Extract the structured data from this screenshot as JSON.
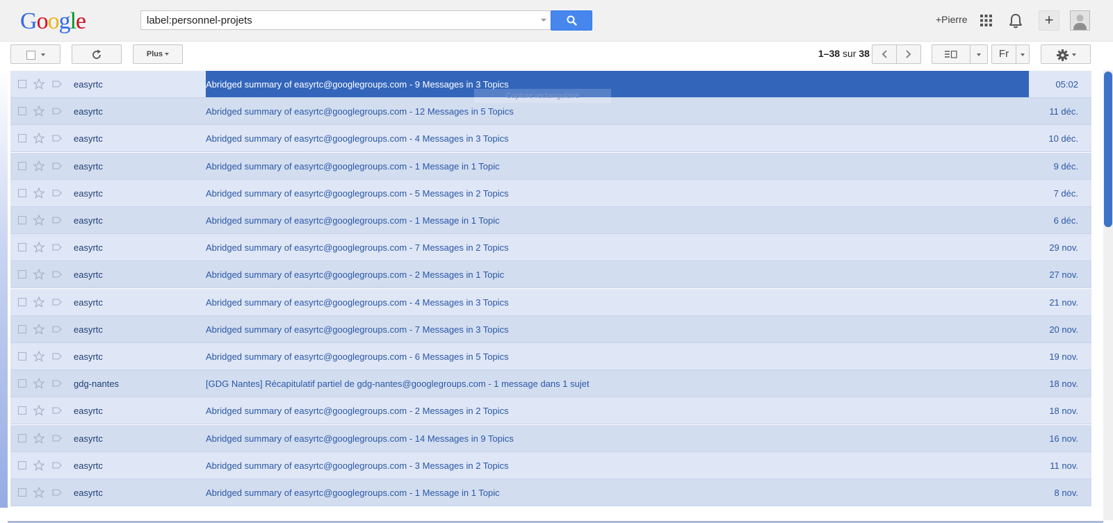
{
  "header": {
    "logo": {
      "letters": [
        "G",
        "o",
        "o",
        "g",
        "l",
        "e"
      ]
    },
    "search": {
      "value": "label:personnel-projets",
      "button_icon": "search-icon"
    },
    "user_link": "+Pierre",
    "share_label": "+"
  },
  "toolbar": {
    "more_label": "Plus",
    "pagination": {
      "range": "1–38",
      "of": "sur",
      "total": "38"
    },
    "language": "Fr"
  },
  "tooltip": "Capture rectangulaire",
  "messages": [
    {
      "sender": "easyrtc",
      "subject": "Abridged summary of easyrtc@googlegroups.com - 9 Messages in 3 Topics",
      "date": "05:02",
      "selected": true
    },
    {
      "sender": "easyrtc",
      "subject": "Abridged summary of easyrtc@googlegroups.com - 12 Messages in 5 Topics",
      "date": "11 déc."
    },
    {
      "sender": "easyrtc",
      "subject": "Abridged summary of easyrtc@googlegroups.com - 4 Messages in 3 Topics",
      "date": "10 déc."
    },
    {
      "sender": "easyrtc",
      "subject": "Abridged summary of easyrtc@googlegroups.com - 1 Message in 1 Topic",
      "date": "9 déc."
    },
    {
      "sender": "easyrtc",
      "subject": "Abridged summary of easyrtc@googlegroups.com - 5 Messages in 2 Topics",
      "date": "7 déc."
    },
    {
      "sender": "easyrtc",
      "subject": "Abridged summary of easyrtc@googlegroups.com - 1 Message in 1 Topic",
      "date": "6 déc."
    },
    {
      "sender": "easyrtc",
      "subject": "Abridged summary of easyrtc@googlegroups.com - 7 Messages in 2 Topics",
      "date": "29 nov."
    },
    {
      "sender": "easyrtc",
      "subject": "Abridged summary of easyrtc@googlegroups.com - 2 Messages in 1 Topic",
      "date": "27 nov."
    },
    {
      "sender": "easyrtc",
      "subject": "Abridged summary of easyrtc@googlegroups.com - 4 Messages in 3 Topics",
      "date": "21 nov."
    },
    {
      "sender": "easyrtc",
      "subject": "Abridged summary of easyrtc@googlegroups.com - 7 Messages in 3 Topics",
      "date": "20 nov."
    },
    {
      "sender": "easyrtc",
      "subject": "Abridged summary of easyrtc@googlegroups.com - 6 Messages in 5 Topics",
      "date": "19 nov."
    },
    {
      "sender": "gdg-nantes",
      "subject": "[GDG Nantes] Récapitulatif partiel de gdg-nantes@googlegroups.com - 1 message dans 1 sujet",
      "date": "18 nov."
    },
    {
      "sender": "easyrtc",
      "subject": "Abridged summary of easyrtc@googlegroups.com - 2 Messages in 2 Topics",
      "date": "18 nov."
    },
    {
      "sender": "easyrtc",
      "subject": "Abridged summary of easyrtc@googlegroups.com - 14 Messages in 9 Topics",
      "date": "16 nov."
    },
    {
      "sender": "easyrtc",
      "subject": "Abridged summary of easyrtc@googlegroups.com - 3 Messages in 2 Topics",
      "date": "11 nov."
    },
    {
      "sender": "easyrtc",
      "subject": "Abridged summary of easyrtc@googlegroups.com - 1 Message in 1 Topic",
      "date": "8 nov."
    }
  ],
  "colors": {
    "accent": "#4787ed",
    "selection": "#3366bb",
    "link": "#2a58a6",
    "scrollbar": "#3c73c8"
  }
}
